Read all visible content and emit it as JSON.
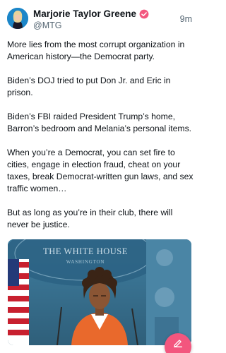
{
  "post": {
    "author": {
      "display_name": "Marjorie Taylor Greene",
      "handle": "@MTG",
      "verified": true
    },
    "timestamp": "9m",
    "paragraphs": [
      "More lies from the most corrupt organization in American history—the Democrat party.",
      "Biden’s DOJ tried to put Don Jr. and Eric in prison.",
      "Biden’s FBI raided President Trump’s home, Barron’s bedroom and Melania’s personal items.",
      "When you’re a Democrat, you can set fire to cities, engage in election fraud, cheat on your taxes, break Democrat-written gun laws, and sex traffic women…",
      "But as long as you’re in their club, there will never be justice."
    ],
    "media": {
      "backdrop_text_1": "THE WHITE HOUSE",
      "backdrop_text_2": "WASHINGTON"
    }
  },
  "colors": {
    "verified_badge": "#f3567e",
    "compose_button": "#f3567e",
    "secondary_text": "#536471"
  },
  "icons": {
    "verified": "verified-badge-icon",
    "compose": "compose-edit-icon"
  }
}
